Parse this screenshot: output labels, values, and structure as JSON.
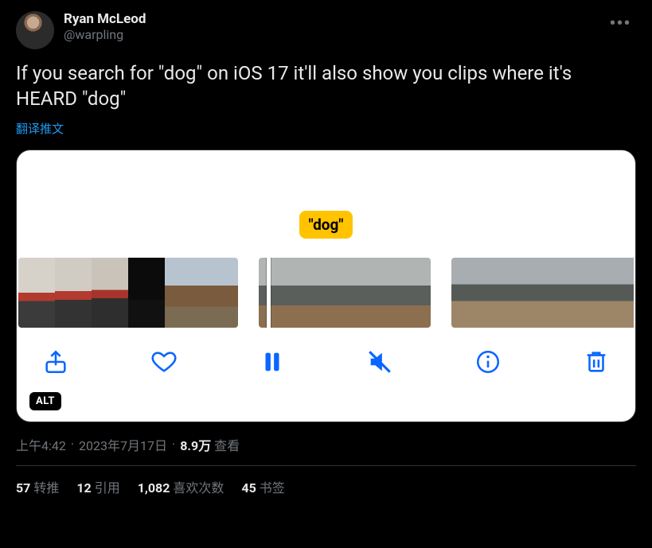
{
  "author": {
    "display_name": "Ryan McLeod",
    "handle": "@warpling"
  },
  "tweet_text": "If you search for \"dog\" on iOS 17 it'll also show you clips where it's HEARD \"dog\"",
  "translate_label": "翻译推文",
  "media": {
    "search_tag": "\"dog\"",
    "alt_badge": "ALT",
    "toolbar_icons": {
      "share": "share-icon",
      "heart": "heart-icon",
      "pause": "pause-icon",
      "mute": "mute-icon",
      "info": "info-icon",
      "trash": "trash-icon"
    }
  },
  "meta": {
    "time": "上午4:42",
    "date": "2023年7月17日",
    "views_count": "8.9万",
    "views_label": "查看"
  },
  "stats": {
    "retweets_count": "57",
    "retweets_label": "转推",
    "quotes_count": "12",
    "quotes_label": "引用",
    "likes_count": "1,082",
    "likes_label": "喜欢次数",
    "bookmarks_count": "45",
    "bookmarks_label": "书签"
  }
}
